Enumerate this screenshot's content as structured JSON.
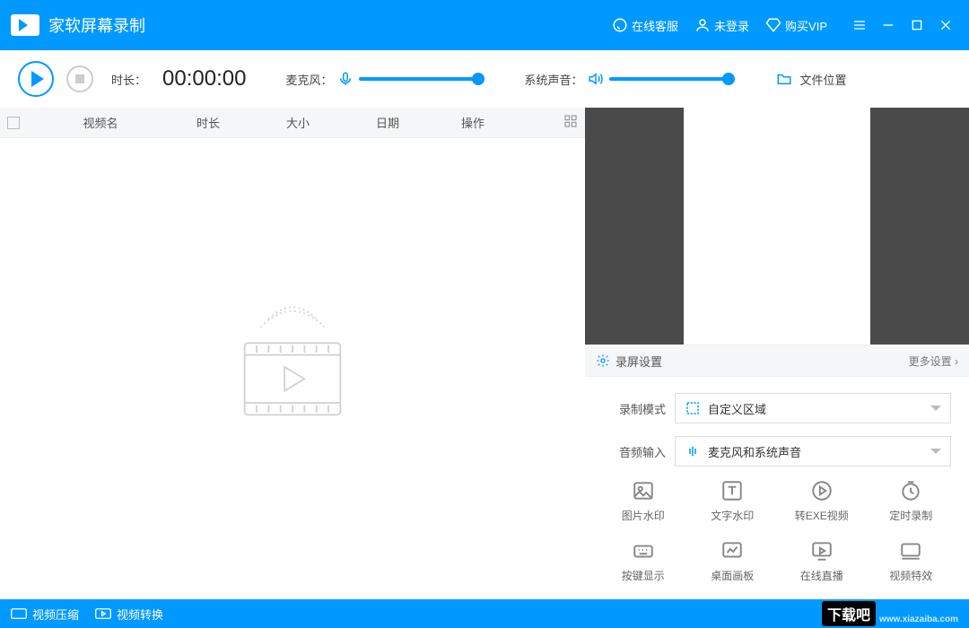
{
  "title": "家软屏幕录制",
  "titlebar": {
    "support": "在线客服",
    "login": "未登录",
    "vip": "购买VIP"
  },
  "toolbar": {
    "duration_label": "时长：",
    "duration_value": "00:00:00",
    "mic_label": "麦克风：",
    "system_audio_label": "系统声音：",
    "file_location": "文件位置"
  },
  "list": {
    "columns": {
      "name": "视频名",
      "duration": "时长",
      "size": "大小",
      "date": "日期",
      "actions": "操作"
    }
  },
  "settings": {
    "head": "录屏设置",
    "more": "更多设置",
    "mode_label": "录制模式",
    "mode_value": "自定义区域",
    "audio_label": "音频输入",
    "audio_value": "麦克风和系统声音",
    "tools": [
      "图片水印",
      "文字水印",
      "转EXE视频",
      "定时录制",
      "按键显示",
      "桌面画板",
      "在线直播",
      "视频特效"
    ]
  },
  "footer": {
    "compress": "视频压缩",
    "convert": "视频转换",
    "brand": "下载吧",
    "brand_url": "www.xiazaiba.com"
  }
}
